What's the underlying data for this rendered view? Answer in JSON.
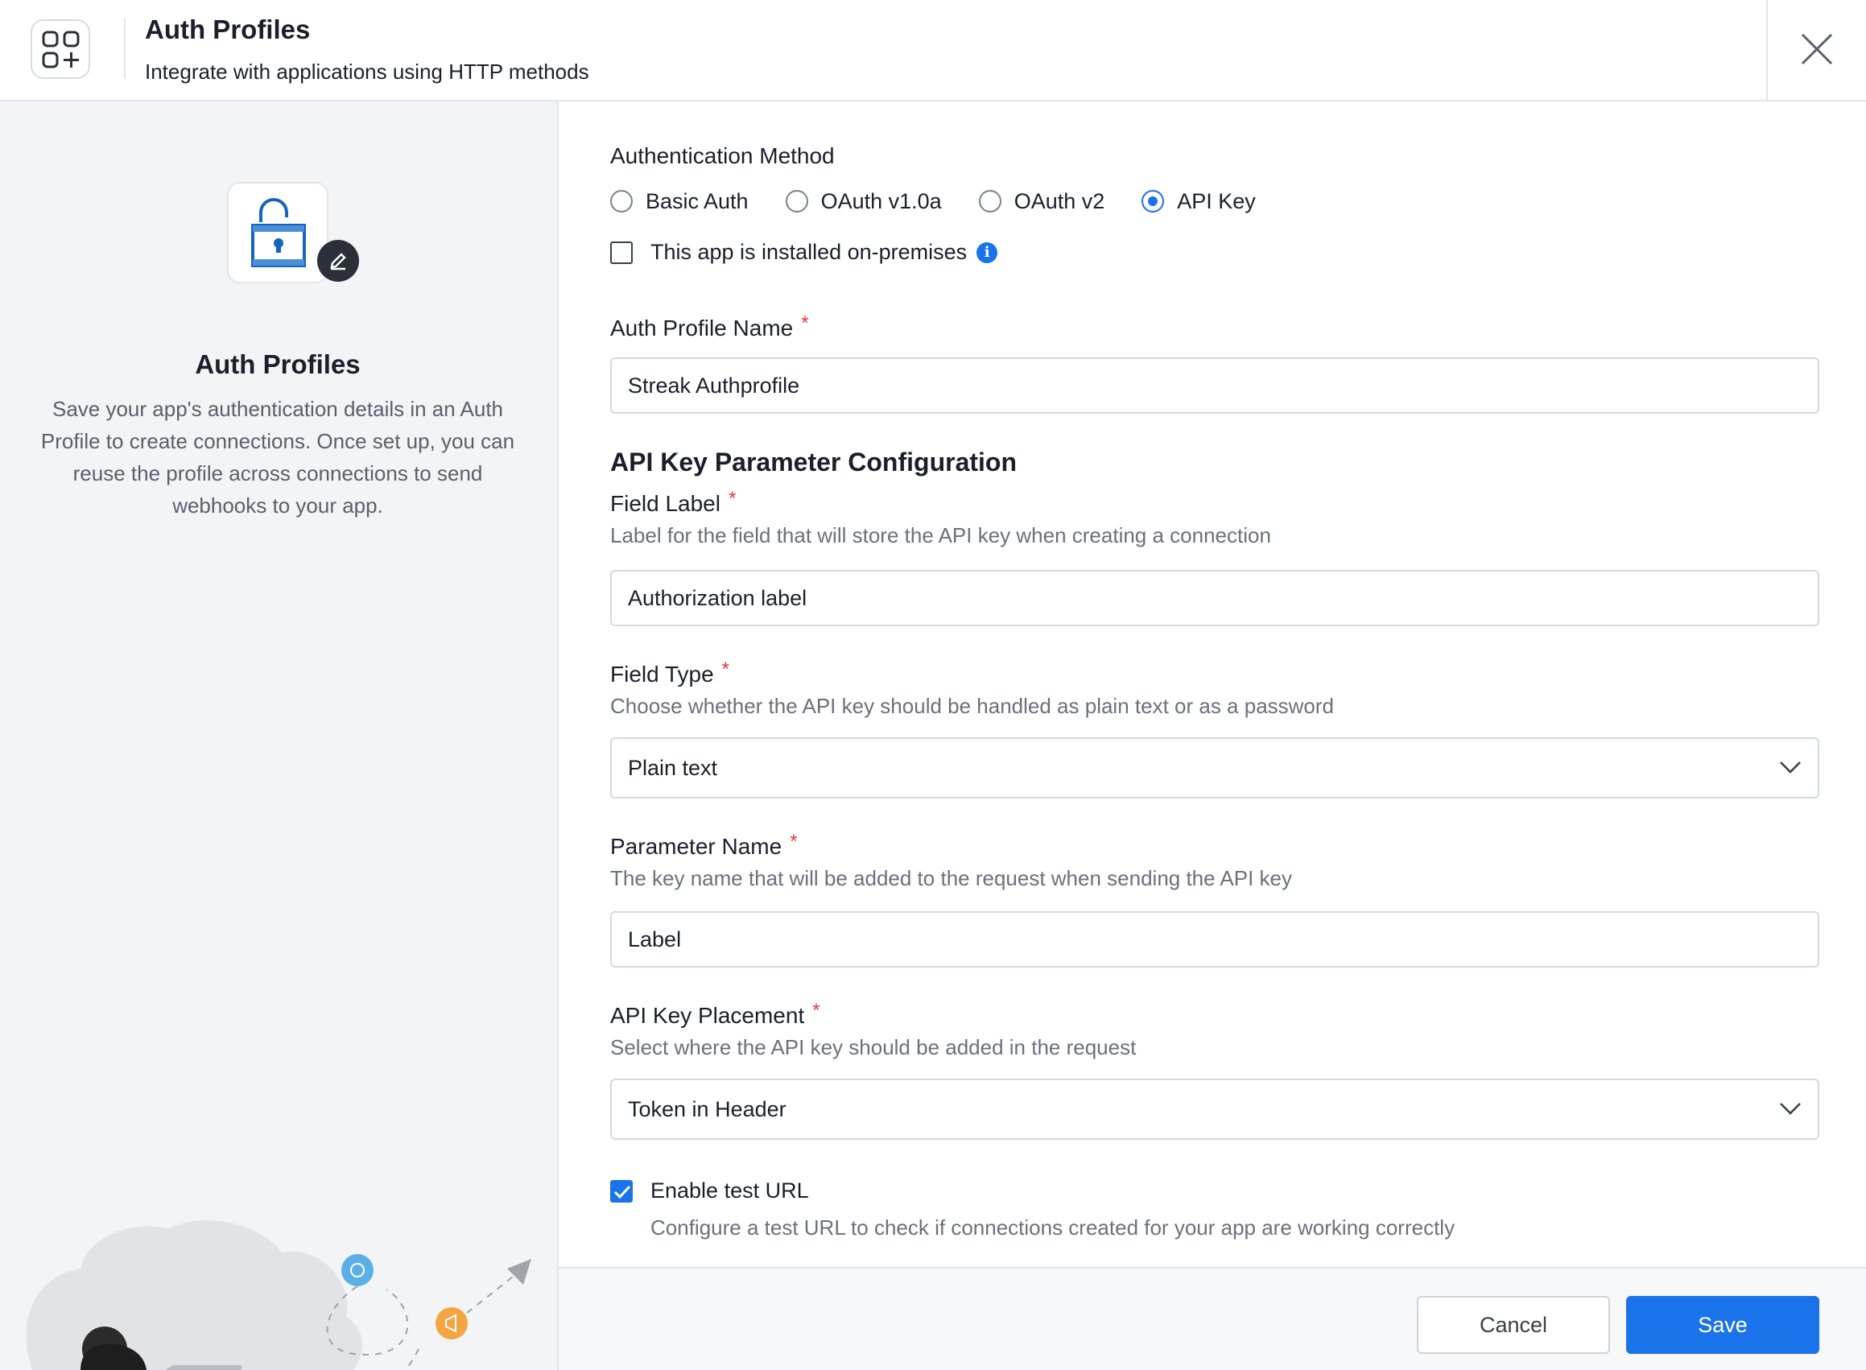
{
  "header": {
    "title": "Auth Profiles",
    "subtitle": "Integrate with applications using HTTP methods",
    "app_icon": "apps-add-icon",
    "close_icon": "close-icon"
  },
  "left_panel": {
    "title": "Auth Profiles",
    "description": "Save your app's authentication details in an Auth Profile to create connections. Once set up, you can reuse the profile across connections to send webhooks to your app."
  },
  "form": {
    "auth_method": {
      "label": "Authentication Method",
      "options": [
        "Basic Auth",
        "OAuth v1.0a",
        "OAuth v2",
        "API Key"
      ],
      "selected": "API Key"
    },
    "on_premises": {
      "label": "This app is installed on-premises",
      "checked": false
    },
    "profile_name": {
      "label": "Auth Profile Name",
      "required_mark": "*",
      "value": "Streak Authprofile"
    },
    "api_key_section_title": "API Key Parameter Configuration",
    "field_label": {
      "label": "Field Label",
      "required_mark": "*",
      "helper": "Label for the field that will store the API key when creating a connection",
      "value": "Authorization label"
    },
    "field_type": {
      "label": "Field Type",
      "required_mark": "*",
      "helper": "Choose whether the API key should be handled as plain text or as a password",
      "value": "Plain text"
    },
    "parameter_name": {
      "label": "Parameter Name",
      "required_mark": "*",
      "helper": "The key name that will be added to the request when sending the API key",
      "value": "Label"
    },
    "key_placement": {
      "label": "API Key Placement",
      "required_mark": "*",
      "helper": "Select where the API key should be added in the request",
      "value": "Token in Header"
    },
    "test_url": {
      "label": "Enable test URL",
      "helper": "Configure a test URL to check if connections created for your app are working correctly",
      "checked": true
    }
  },
  "footer": {
    "cancel_label": "Cancel",
    "save_label": "Save"
  },
  "colors": {
    "accent": "#1a73e8",
    "required": "#e2373a",
    "panel_bg": "#f3f4f6"
  }
}
